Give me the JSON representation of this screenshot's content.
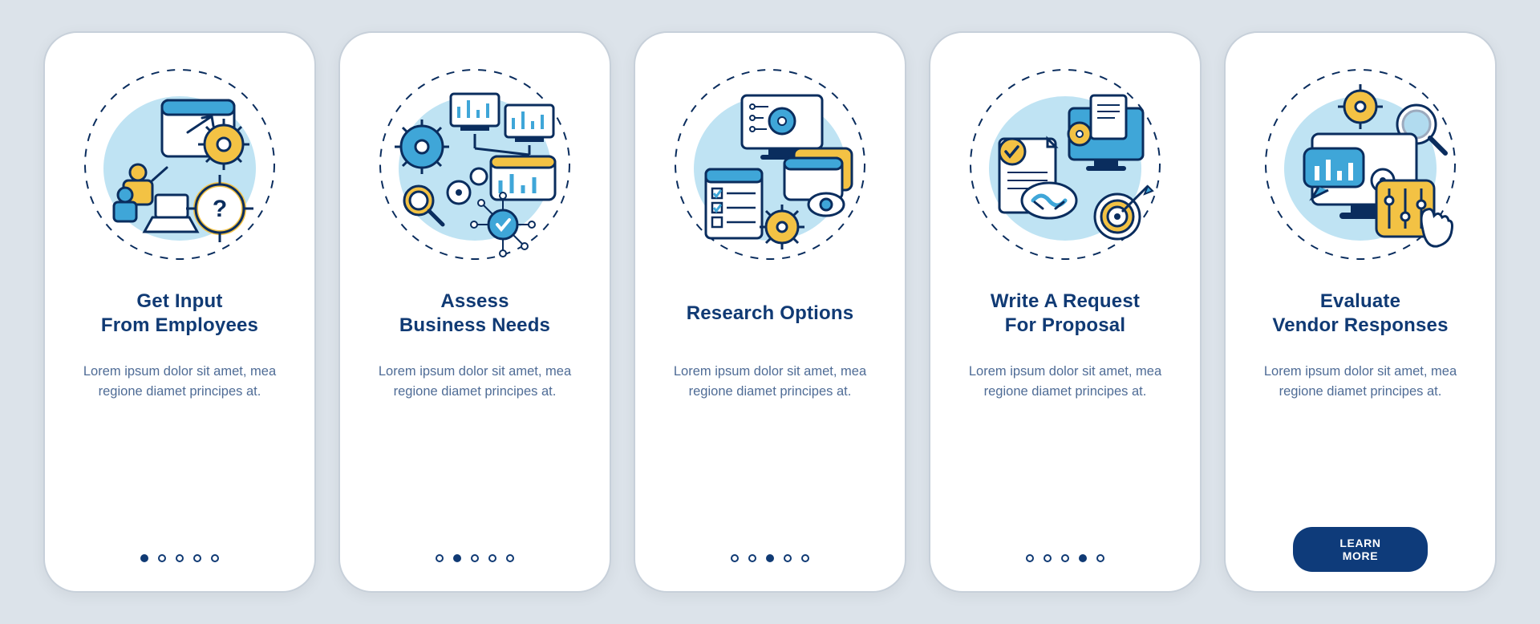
{
  "colors": {
    "accent_blue": "#3fa6d8",
    "accent_yellow": "#f3c244",
    "stroke": "#0a2d5e",
    "title": "#103a74"
  },
  "lorem": "Lorem ipsum dolor sit amet, mea regione diamet principes at.",
  "cta_label": "LEARN MORE",
  "cards": [
    {
      "title": "Get Input\nFrom Employees",
      "active_dot": 0,
      "has_cta": false,
      "icon": "input-employees"
    },
    {
      "title": "Assess\nBusiness Needs",
      "active_dot": 1,
      "has_cta": false,
      "icon": "assess-needs"
    },
    {
      "title": "Research Options",
      "active_dot": 2,
      "has_cta": false,
      "icon": "research-options"
    },
    {
      "title": "Write A Request\nFor Proposal",
      "active_dot": 3,
      "has_cta": false,
      "icon": "write-proposal"
    },
    {
      "title": "Evaluate\nVendor Responses",
      "active_dot": 4,
      "has_cta": true,
      "icon": "evaluate-responses"
    }
  ]
}
